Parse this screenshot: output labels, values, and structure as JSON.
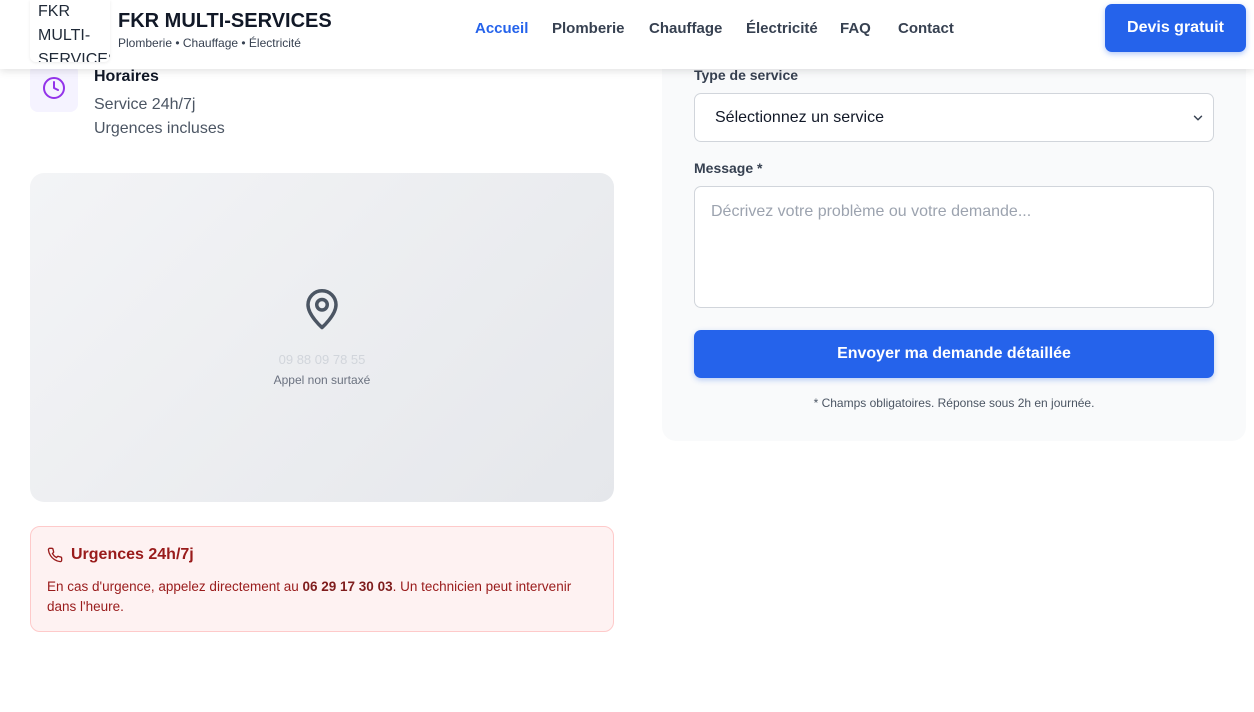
{
  "header": {
    "logo_alt": "FKR MULTI-SERVICES",
    "brand_title": "FKR MULTI-SERVICES",
    "brand_subtitle": "Plomberie • Chauffage • Électricité",
    "nav": [
      {
        "label": "Accueil",
        "active": true
      },
      {
        "label": "Plomberie",
        "active": false
      },
      {
        "label": "Chauffage",
        "active": false
      },
      {
        "label": "Électricité",
        "active": false
      },
      {
        "label": "FAQ",
        "active": false
      },
      {
        "label": "Contact",
        "active": false
      }
    ],
    "cta_label": "Devis gratuit"
  },
  "hours": {
    "icon": "clock-icon",
    "title": "Horaires",
    "line1": "Service 24h/7j",
    "line2": "Urgences incluses"
  },
  "map": {
    "icon": "map-pin-icon",
    "phone": "09 88 09 78 55",
    "note": "Appel non surtaxé"
  },
  "urgent": {
    "icon": "phone-icon",
    "title": "Urgences 24h/7j",
    "text_before": "En cas d'urgence, appelez directement au ",
    "phone": "06 29 17 30 03",
    "text_after": ". Un technicien peut intervenir dans l'heure."
  },
  "form": {
    "service_label": "Type de service",
    "service_selected": "Sélectionnez un service",
    "message_label": "Message *",
    "message_placeholder": "Décrivez votre problème ou votre demande...",
    "submit_label": "Envoyer ma demande détaillée",
    "footnote": "* Champs obligatoires. Réponse sous 2h en journée."
  },
  "colors": {
    "primary": "#2563eb",
    "urgent_bg": "#fef2f2",
    "urgent_text": "#991b1b",
    "clock_icon": "#9333ea"
  }
}
